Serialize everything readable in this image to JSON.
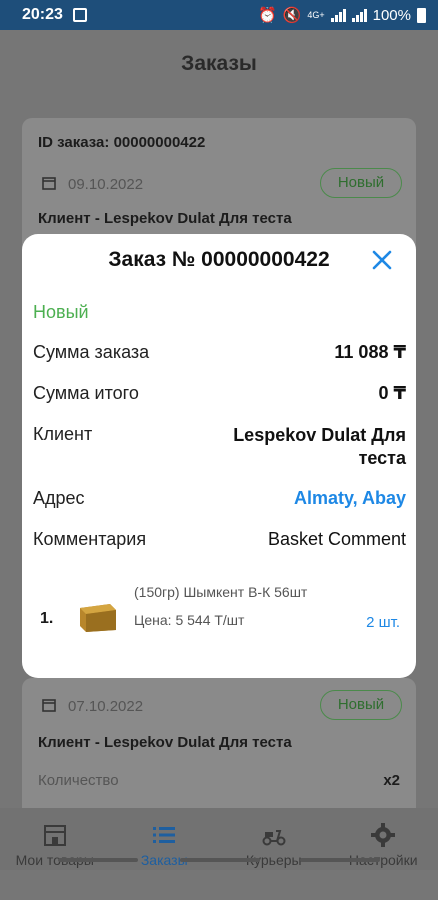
{
  "status_bar": {
    "time": "20:23",
    "battery": "100%",
    "network": "4G+"
  },
  "app": {
    "title": "Заказы"
  },
  "order_card_1": {
    "id_label": "ID заказа: 00000000422",
    "date": "09.10.2022",
    "status": "Новый",
    "client": "Клиент - Lespekov Dulat Для теста"
  },
  "order_card_2": {
    "date": "07.10.2022",
    "status": "Новый",
    "client": "Клиент - Lespekov Dulat Для теста",
    "quantity_label": "Количество",
    "quantity_value": "x2"
  },
  "modal": {
    "title": "Заказ № 00000000422",
    "status": "Новый",
    "rows": [
      {
        "label": "Сумма заказа",
        "value": "11 088 ₸"
      },
      {
        "label": "Сумма итого",
        "value": "0 ₸"
      },
      {
        "label": "Клиент",
        "value": "Lespekov Dulat Для теста"
      },
      {
        "label": "Адрес",
        "value": "Almaty, Abay"
      },
      {
        "label": "Комментария",
        "value": "Basket Comment"
      }
    ],
    "item": {
      "index": "1.",
      "name": "(150гр) Шымкент В-К 56шт",
      "price": "Цена: 5 544 Т/шт",
      "qty": "2 шт."
    },
    "accent_color": "#1e88e5",
    "status_color": "#4caf50"
  },
  "bottom_nav": {
    "items": [
      {
        "label": "Мои товары",
        "icon": "store-icon"
      },
      {
        "label": "Заказы",
        "icon": "list-icon"
      },
      {
        "label": "Курьеры",
        "icon": "scooter-icon"
      },
      {
        "label": "Настройки",
        "icon": "gear-icon"
      }
    ],
    "active_index": 1
  }
}
